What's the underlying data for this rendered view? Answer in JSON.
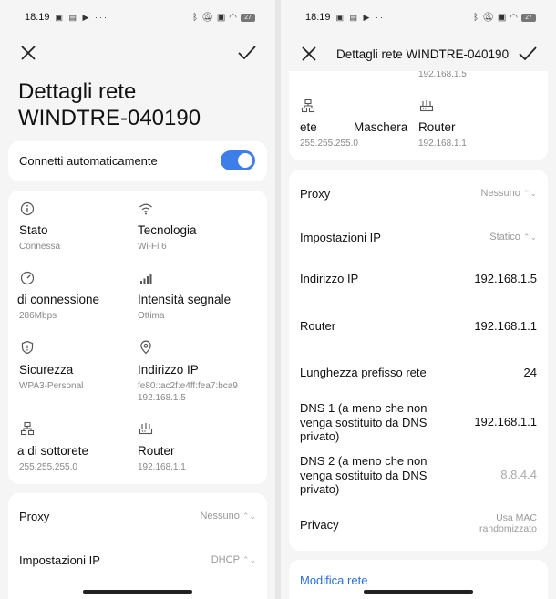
{
  "status": {
    "time": "18:19",
    "battery": "27"
  },
  "left": {
    "title_line1": "Dettagli rete",
    "title_line2": "WINDTRE-040190",
    "auto_connect_label": "Connetti automaticamente",
    "grid": [
      {
        "title": "Stato",
        "value": "Connessa",
        "icon": "info-icon"
      },
      {
        "title": "Tecnologia",
        "value": "Wi-Fi 6",
        "icon": "wifi-icon"
      },
      {
        "title": "di connessione",
        "value": "286Mbps",
        "icon": "speed-icon"
      },
      {
        "title": "Intensità segnale",
        "value": "Ottima",
        "icon": "signal-bars-icon"
      },
      {
        "title": "Sicurezza",
        "value": "WPA3-Personal",
        "icon": "shield-icon"
      },
      {
        "title": "Indirizzo IP",
        "value": "fe80::ac2f:e4ff:fea7:bca9",
        "value2": "192.168.1.5",
        "icon": "location-pin-icon"
      },
      {
        "title": "a di sottorete",
        "value": "255.255.255.0",
        "icon": "network-icon"
      },
      {
        "title": "Router",
        "value": "192.168.1.1",
        "icon": "router-icon"
      }
    ],
    "proxy_label": "Proxy",
    "proxy_value": "Nessuno",
    "ip_settings_label": "Impostazioni IP",
    "ip_settings_value": "DHCP"
  },
  "right": {
    "header_title": "Dettagli rete WINDTRE-040190",
    "top_partial_ip": "192.168.1.5",
    "top_cells": [
      {
        "title": "ete",
        "value": "255.255.255.0"
      },
      {
        "title": "Maschera",
        "value": ""
      },
      {
        "title": "Router",
        "value": "192.168.1.1"
      }
    ],
    "rows": [
      {
        "label": "Proxy",
        "value": "Nessuno"
      },
      {
        "label": "Impostazioni IP",
        "value": "Statico"
      },
      {
        "label": "Indirizzo IP",
        "value": "192.168.1.5"
      },
      {
        "label": "Router",
        "value": "192.168.1.1"
      },
      {
        "label": "Lunghezza prefisso rete",
        "value": "24"
      },
      {
        "label_l1": "DNS 1 (a meno che non",
        "label_l2": "venga sostituito da DNS",
        "label_l3": "privato)",
        "value": "192.168.1.1"
      },
      {
        "label_l1": "DNS 2 (a meno che non",
        "label_l2": "venga sostituito da DNS",
        "label_l3": "privato)",
        "value": "8.8.4.4"
      },
      {
        "label": "Privacy",
        "value_l1": "Usa MAC",
        "value_l2": "randomizzato"
      }
    ],
    "modify_link": "Modifica rete"
  }
}
